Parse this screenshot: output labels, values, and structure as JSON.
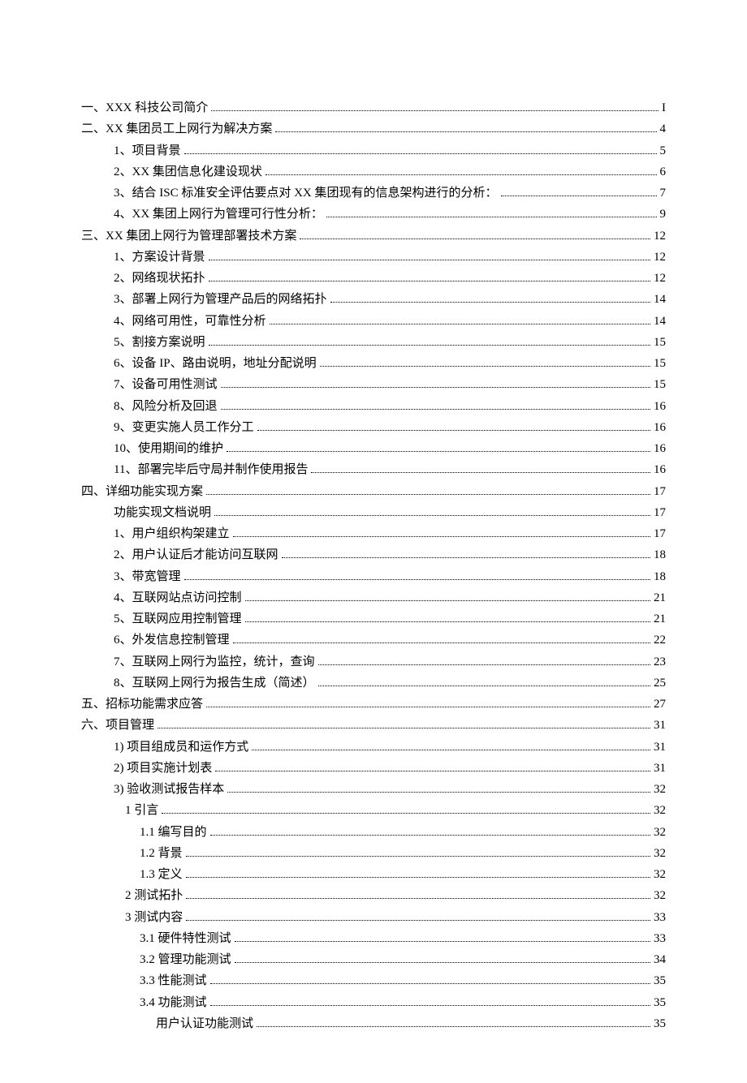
{
  "toc": [
    {
      "indent": 0,
      "label": "一、XXX 科技公司简介",
      "page": "I"
    },
    {
      "indent": 0,
      "label": "二、XX 集团员工上网行为解决方案",
      "page": "4"
    },
    {
      "indent": 1,
      "label": "1、项目背景",
      "page": "5"
    },
    {
      "indent": 1,
      "label": "2、XX 集团信息化建设现状",
      "page": "6"
    },
    {
      "indent": 1,
      "label": "3、结合 ISC 标准安全评估要点对 XX 集团现有的信息架构进行的分析：",
      "page": "7"
    },
    {
      "indent": 1,
      "label": "4、XX 集团上网行为管理可行性分析：",
      "page": "9"
    },
    {
      "indent": 0,
      "label": "三、XX 集团上网行为管理部署技术方案",
      "page": "12"
    },
    {
      "indent": 1,
      "label": "1、方案设计背景",
      "page": "12"
    },
    {
      "indent": 1,
      "label": "2、网络现状拓扑",
      "page": "12"
    },
    {
      "indent": 1,
      "label": "3、部署上网行为管理产品后的网络拓扑",
      "page": "14"
    },
    {
      "indent": 1,
      "label": "4、网络可用性，可靠性分析",
      "page": "14"
    },
    {
      "indent": 1,
      "label": "5、割接方案说明",
      "page": "15"
    },
    {
      "indent": 1,
      "label": "6、设备 IP、路由说明，地址分配说明",
      "page": "15"
    },
    {
      "indent": 1,
      "label": "7、设备可用性测试",
      "page": "15"
    },
    {
      "indent": 1,
      "label": "8、风险分析及回退",
      "page": "16"
    },
    {
      "indent": 1,
      "label": "9、变更实施人员工作分工",
      "page": "16"
    },
    {
      "indent": 1,
      "label": "10、使用期间的维护",
      "page": "16"
    },
    {
      "indent": 1,
      "label": "11、部署完毕后守局并制作使用报告",
      "page": "16"
    },
    {
      "indent": 0,
      "label": "四、详细功能实现方案",
      "page": "17"
    },
    {
      "indent": 1,
      "label": "功能实现文档说明",
      "page": "17"
    },
    {
      "indent": 1,
      "label": "1、用户组织构架建立",
      "page": "17"
    },
    {
      "indent": 1,
      "label": "2、用户认证后才能访问互联网",
      "page": "18"
    },
    {
      "indent": 1,
      "label": "3、带宽管理",
      "page": "18"
    },
    {
      "indent": 1,
      "label": "4、互联网站点访问控制",
      "page": "21"
    },
    {
      "indent": 1,
      "label": "5、互联网应用控制管理",
      "page": "21"
    },
    {
      "indent": 1,
      "label": "6、外发信息控制管理",
      "page": "22"
    },
    {
      "indent": 1,
      "label": "7、互联网上网行为监控，统计，查询",
      "page": "23"
    },
    {
      "indent": 1,
      "label": "8、互联网上网行为报告生成（简述）",
      "page": "25"
    },
    {
      "indent": 0,
      "label": "五、招标功能需求应答",
      "page": "27"
    },
    {
      "indent": 0,
      "label": "六、项目管理",
      "page": "31"
    },
    {
      "indent": 1,
      "label": "1)  项目组成员和运作方式",
      "page": "31"
    },
    {
      "indent": 1,
      "label": "2)  项目实施计划表",
      "page": "31"
    },
    {
      "indent": 1,
      "label": "3)  验收测试报告样本",
      "page": "32"
    },
    {
      "indent": 2,
      "label": "1 引言",
      "page": "32"
    },
    {
      "indent": 3,
      "label": "1.1   编写目的",
      "page": "32"
    },
    {
      "indent": 3,
      "label": "1.2   背景",
      "page": "32"
    },
    {
      "indent": 3,
      "label": "1.3   定义",
      "page": "32"
    },
    {
      "indent": 2,
      "label": "2 测试拓扑",
      "page": "32"
    },
    {
      "indent": 2,
      "label": "3 测试内容",
      "page": "33"
    },
    {
      "indent": 3,
      "label": "3.1   硬件特性测试",
      "page": "33"
    },
    {
      "indent": 3,
      "label": "3.2   管理功能测试",
      "page": "34"
    },
    {
      "indent": 3,
      "label": "3.3   性能测试",
      "page": "35"
    },
    {
      "indent": 3,
      "label": "3.4   功能测试",
      "page": "35"
    },
    {
      "indent": 4,
      "label": "用户认证功能测试",
      "page": "35"
    }
  ]
}
